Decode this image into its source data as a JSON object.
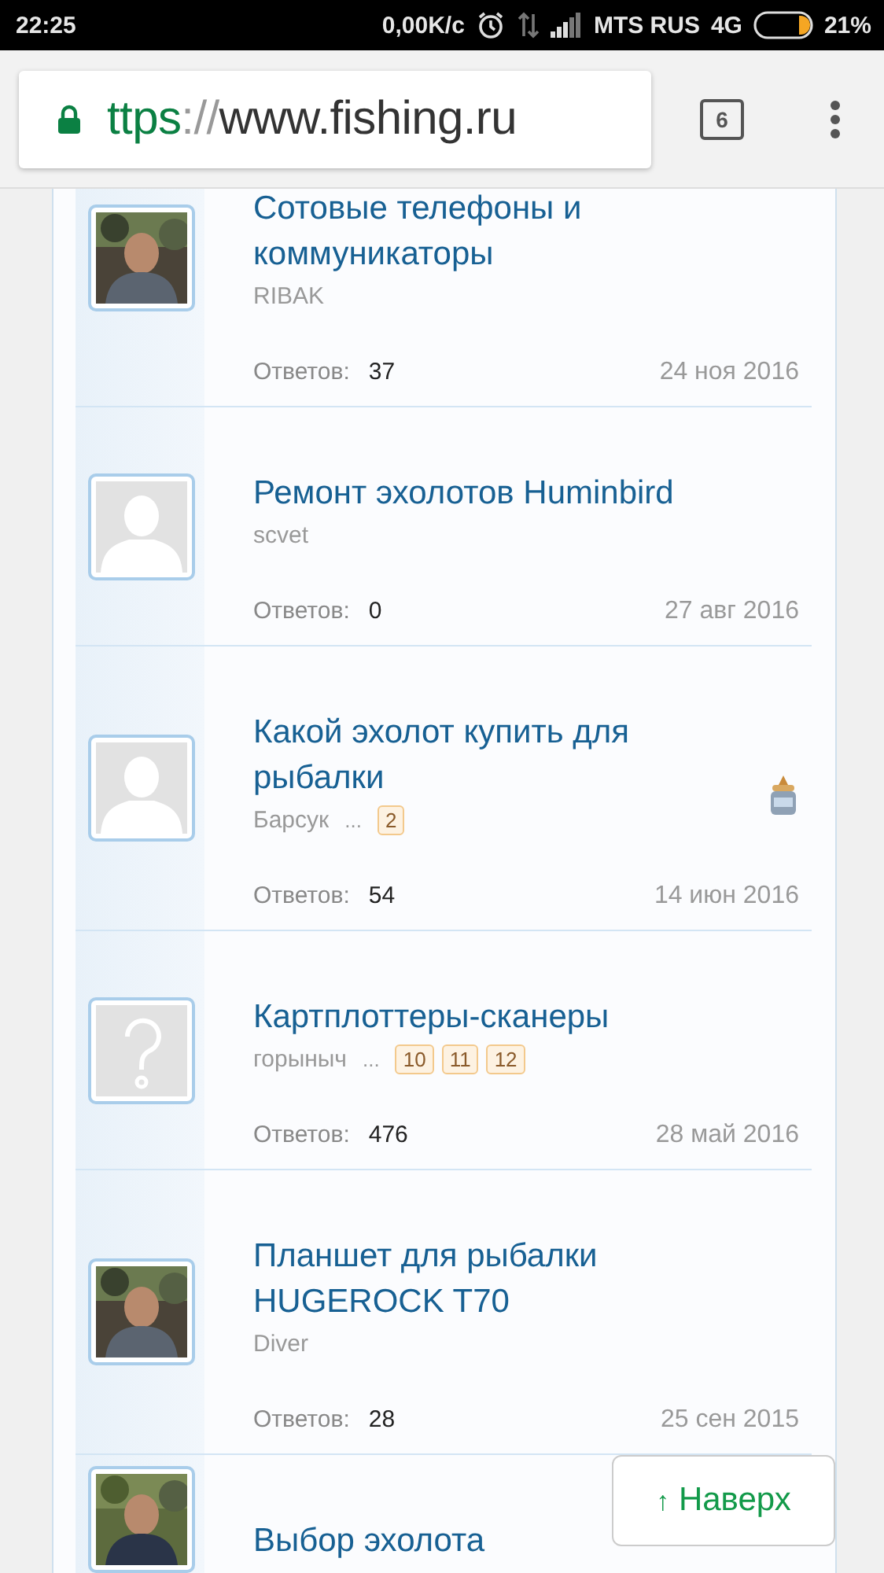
{
  "status_bar": {
    "time": "22:25",
    "speed": "0,00K/с",
    "carrier": "MTS RUS",
    "network": "4G",
    "battery": "21%"
  },
  "browser": {
    "url_scheme": "ttps",
    "url_separator": "://",
    "url_host": "www.fishing.ru",
    "secure": true,
    "tab_count": "6"
  },
  "threads": [
    {
      "title": "Сотовые телефоны и коммуникаторы",
      "author": "RIBAK",
      "sticky": false,
      "replies_label": "Ответов:",
      "replies": "37",
      "date": "24 ноя 2016"
    },
    {
      "title": "Ремонт эхолотов Huminbird",
      "author": "scvet",
      "avatar": {
        "kind": "default"
      },
      "sticky": false,
      "replies_label": "Ответов:",
      "replies": "0",
      "date": "27 авг 2016"
    },
    {
      "title": "Какой эхолот купить для рыбалки",
      "author": "Барсук",
      "avatar": {
        "kind": "default"
      },
      "ellipsis": "...",
      "pages": [
        "2"
      ],
      "sticky": true,
      "replies_label": "Ответов:",
      "replies": "54",
      "date": "14 июн 2016"
    },
    {
      "title": "Картплоттеры-сканеры",
      "author": "горыныч",
      "avatar": {
        "kind": "unknown"
      },
      "ellipsis": "...",
      "pages": [
        "10",
        "11",
        "12"
      ],
      "sticky": false,
      "replies_label": "Ответов:",
      "replies": "476",
      "date": "28 май 2016"
    },
    {
      "title": "Планшет для рыбалки HUGEROCK T70",
      "author": "Diver",
      "sticky": false,
      "replies_label": "Ответов:",
      "replies": "28",
      "date": "25 сен 2015"
    },
    {
      "title": "Выбор эхолота"
    }
  ],
  "back_to_top": {
    "arrow": "↑",
    "label": "Наверх"
  }
}
